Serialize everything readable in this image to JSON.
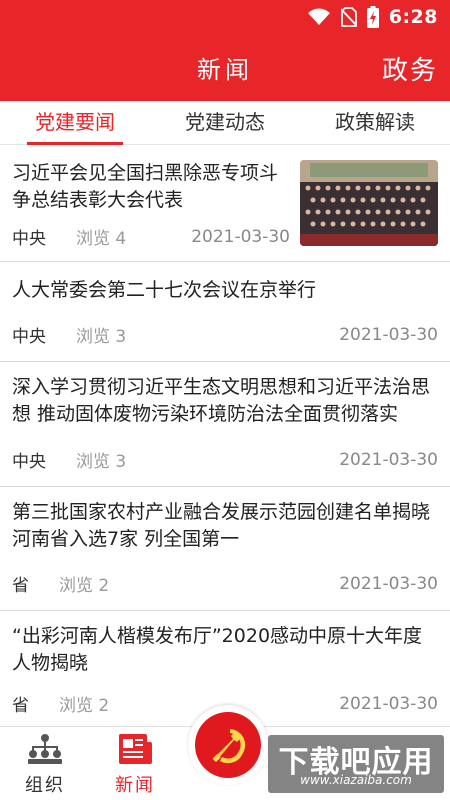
{
  "status_bar": {
    "time": "6:28"
  },
  "header": {
    "title": "新闻",
    "right_title": "政务"
  },
  "tabs": [
    {
      "label": "党建要闻",
      "active": true
    },
    {
      "label": "党建动态",
      "active": false
    },
    {
      "label": "政策解读",
      "active": false
    }
  ],
  "news": [
    {
      "title": "习近平会见全国扫黑除恶专项斗争总结表彰大会代表",
      "source": "中央",
      "views": "浏览 4",
      "date": "2021-03-30",
      "has_image": true
    },
    {
      "title": "人大常委会第二十七次会议在京举行",
      "source": "中央",
      "views": "浏览 3",
      "date": "2021-03-30"
    },
    {
      "title": "深入学习贯彻习近平生态文明思想和习近平法治思想 推动固体废物污染环境防治法全面贯彻落实",
      "source": "中央",
      "views": "浏览 3",
      "date": "2021-03-30"
    },
    {
      "title": "第三批国家农村产业融合发展示范园创建名单揭晓 河南省入选7家 列全国第一",
      "source": "省",
      "views": "浏览 2",
      "date": "2021-03-30"
    },
    {
      "title": "“出彩河南人楷模发布厅”2020感动中原十大年度人物揭晓",
      "source": "省",
      "views": "浏览 2",
      "date": "2021-03-30"
    }
  ],
  "bottom_nav": {
    "items": [
      {
        "label": "组织",
        "icon": "org-chart-icon"
      },
      {
        "label": "新闻",
        "icon": "newspaper-icon",
        "active": true
      }
    ],
    "center_icon": "party-emblem-icon"
  },
  "watermark": {
    "main": "下载吧应用",
    "sub": "www.xiazaiba.com"
  },
  "colors": {
    "primary": "#e8262a",
    "text": "#222222",
    "muted": "#999999"
  }
}
